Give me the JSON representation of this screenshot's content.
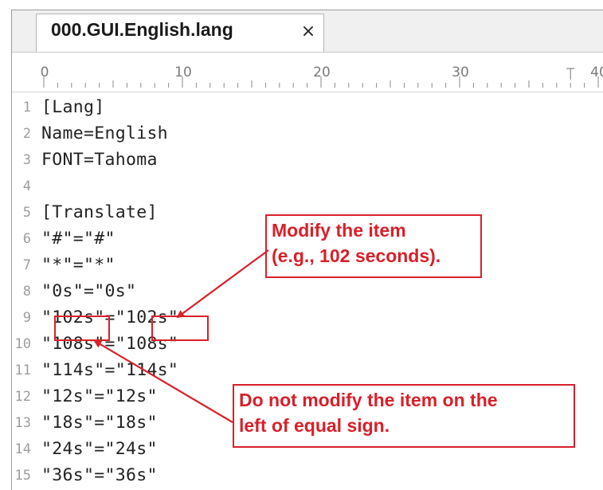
{
  "tab": {
    "title": "000.GUI.English.lang",
    "close": "×"
  },
  "ruler": {
    "labels": [
      "0",
      "10",
      "20",
      "30",
      "40"
    ]
  },
  "lines": [
    {
      "n": "1",
      "text": "[Lang]"
    },
    {
      "n": "2",
      "text": "Name=English"
    },
    {
      "n": "3",
      "text": "FONT=Tahoma"
    },
    {
      "n": "4",
      "text": ""
    },
    {
      "n": "5",
      "text": "[Translate]"
    },
    {
      "n": "6",
      "text": "\"#\"=\"#\""
    },
    {
      "n": "7",
      "text": "\"*\"=\"*\""
    },
    {
      "n": "8",
      "text": "\"0s\"=\"0s\""
    },
    {
      "n": "9",
      "text": "\"102s\"=\"102s\""
    },
    {
      "n": "10",
      "text": "\"108s\"=\"108s\""
    },
    {
      "n": "11",
      "text": "\"114s\"=\"114s\""
    },
    {
      "n": "12",
      "text": "\"12s\"=\"12s\""
    },
    {
      "n": "13",
      "text": "\"18s\"=\"18s\""
    },
    {
      "n": "14",
      "text": "\"24s\"=\"24s\""
    },
    {
      "n": "15",
      "text": "\"36s\"=\"36s\""
    }
  ],
  "annotations": {
    "modify": {
      "line1": "Modify the item",
      "line2": "(e.g., 102 seconds)."
    },
    "do_not_modify": {
      "line1": "Do not modify the item on the",
      "line2": "left of equal sign."
    }
  },
  "colors": {
    "annotation": "#d8202a",
    "line_number": "#9d9d9d"
  }
}
